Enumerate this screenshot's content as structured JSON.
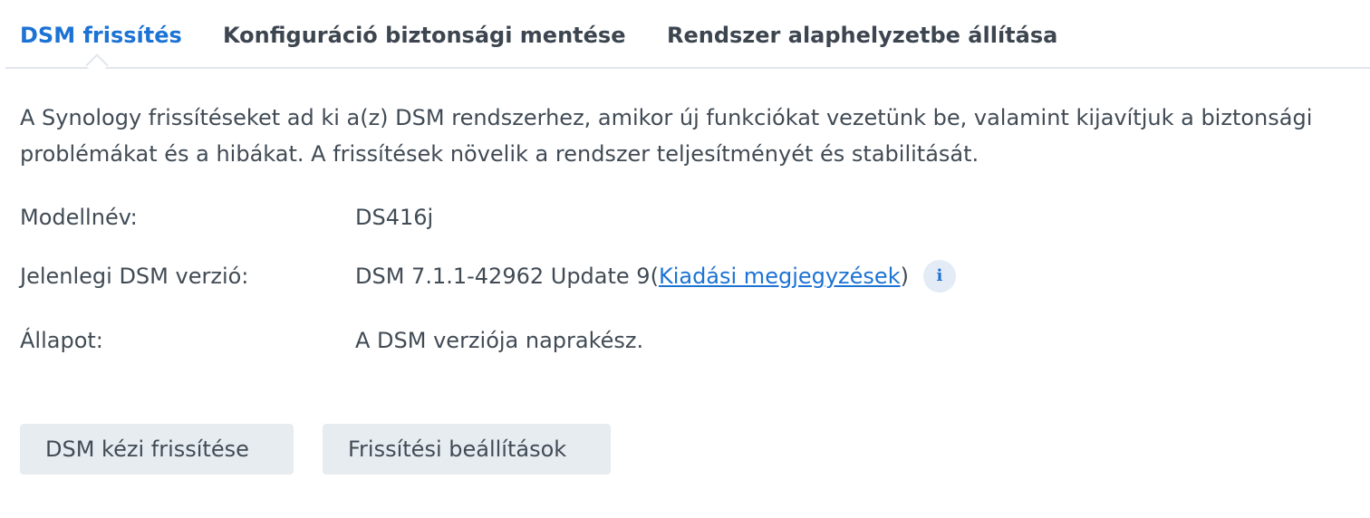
{
  "tabs": [
    {
      "label": "DSM frissítés",
      "active": true
    },
    {
      "label": "Konfiguráció biztonsági mentése",
      "active": false
    },
    {
      "label": "Rendszer alaphelyzetbe állítása",
      "active": false
    }
  ],
  "description": "A Synology frissítéseket ad ki a(z) DSM rendszerhez, amikor új funkciókat vezetünk be, valamint kijavítjuk a biztonsági problémákat és a hibákat. A frissítések növelik a rendszer teljesítményét és stabilitását.",
  "info": {
    "model_label": "Modellnév:",
    "model_value": "DS416j",
    "version_label": "Jelenlegi DSM verzió:",
    "version_value": "DSM 7.1.1-42962 Update 9",
    "paren_open": " (",
    "release_notes_link": "Kiadási megjegyzések",
    "paren_close": ")",
    "info_icon_glyph": "i",
    "status_label": "Állapot:",
    "status_value": "A DSM verziója naprakész."
  },
  "buttons": {
    "manual_update": "DSM kézi frissítése",
    "update_settings": "Frissítési beállítások"
  },
  "colors": {
    "accent": "#1c73d4",
    "status_ok": "#3f9a1e",
    "button_bg": "#e7ecf1"
  }
}
